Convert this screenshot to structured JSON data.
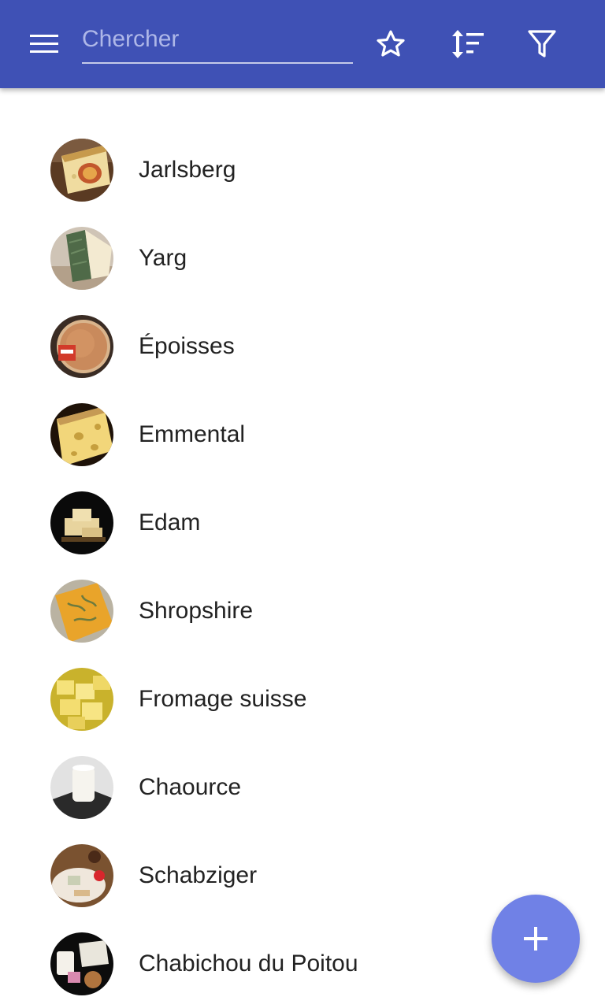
{
  "toolbar": {
    "search_placeholder": "Chercher",
    "menu_icon": "menu-icon",
    "favorite_icon": "star-outline-icon",
    "sort_icon": "sort-icon",
    "filter_icon": "filter-icon",
    "background_color": "#3f51b5"
  },
  "cheeses": [
    {
      "name": "Jarlsberg",
      "image": "cheese-jarlsberg-photo"
    },
    {
      "name": "Yarg",
      "image": "cheese-yarg-photo"
    },
    {
      "name": "Époisses",
      "image": "cheese-epoisses-photo"
    },
    {
      "name": "Emmental",
      "image": "cheese-emmental-photo"
    },
    {
      "name": "Edam",
      "image": "cheese-edam-photo"
    },
    {
      "name": "Shropshire",
      "image": "cheese-shropshire-photo"
    },
    {
      "name": "Fromage suisse",
      "image": "cheese-fromage-suisse-photo"
    },
    {
      "name": "Chaource",
      "image": "cheese-chaource-photo"
    },
    {
      "name": "Schabziger",
      "image": "cheese-schabziger-photo"
    },
    {
      "name": "Chabichou du Poitou",
      "image": "cheese-chabichou-photo"
    }
  ],
  "fab": {
    "icon": "plus-icon",
    "color": "#7081e6"
  }
}
